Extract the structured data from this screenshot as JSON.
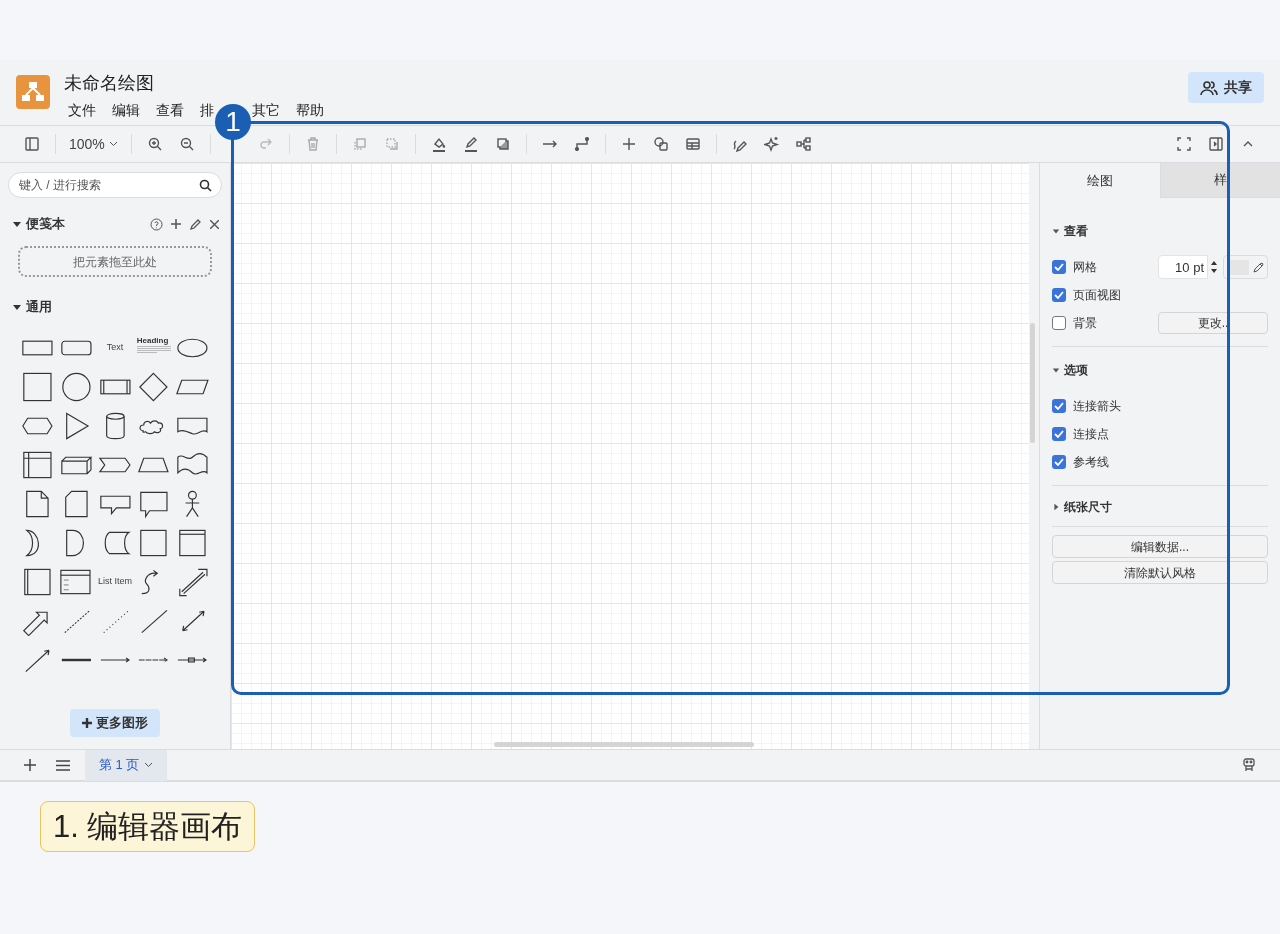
{
  "app": {
    "title": "未命名绘图",
    "menus": [
      "文件",
      "编辑",
      "查看",
      "排",
      "其它",
      "帮助"
    ],
    "share_button": "共享"
  },
  "toolbar": {
    "zoom": "100%"
  },
  "sidebar": {
    "search": {
      "placeholder": "键入 / 进行搜索"
    },
    "scratchpad": {
      "title": "便笺本",
      "expanded": true,
      "drop_hint": "把元素拖至此处"
    },
    "general": {
      "title": "通用",
      "expanded": true
    },
    "shape_labels": [
      "Text",
      "Heading",
      "List Item"
    ],
    "more_shapes": "更多图形"
  },
  "format_panel": {
    "tabs": [
      {
        "label": "绘图",
        "selected": true
      },
      {
        "label": "样",
        "selected": false
      }
    ],
    "view": {
      "title": "查看",
      "expanded": true,
      "grid": {
        "label": "网格",
        "checked": true,
        "size": "10 pt"
      },
      "page_view": {
        "label": "页面视图",
        "checked": true
      },
      "background": {
        "label": "背景",
        "checked": false,
        "button": "更改.."
      }
    },
    "options": {
      "title": "选项",
      "expanded": true,
      "items": [
        {
          "label": "连接箭头",
          "checked": true
        },
        {
          "label": "连接点",
          "checked": true
        },
        {
          "label": "参考线",
          "checked": true
        }
      ]
    },
    "paper_size": {
      "title": "纸张尺寸",
      "expanded": false
    },
    "buttons": [
      "编辑数据...",
      "清除默认风格"
    ]
  },
  "pages": [
    {
      "label": "第 1 页",
      "selected": true
    }
  ],
  "annotation": {
    "badge": "1",
    "caption": "1. 编辑器画布"
  }
}
